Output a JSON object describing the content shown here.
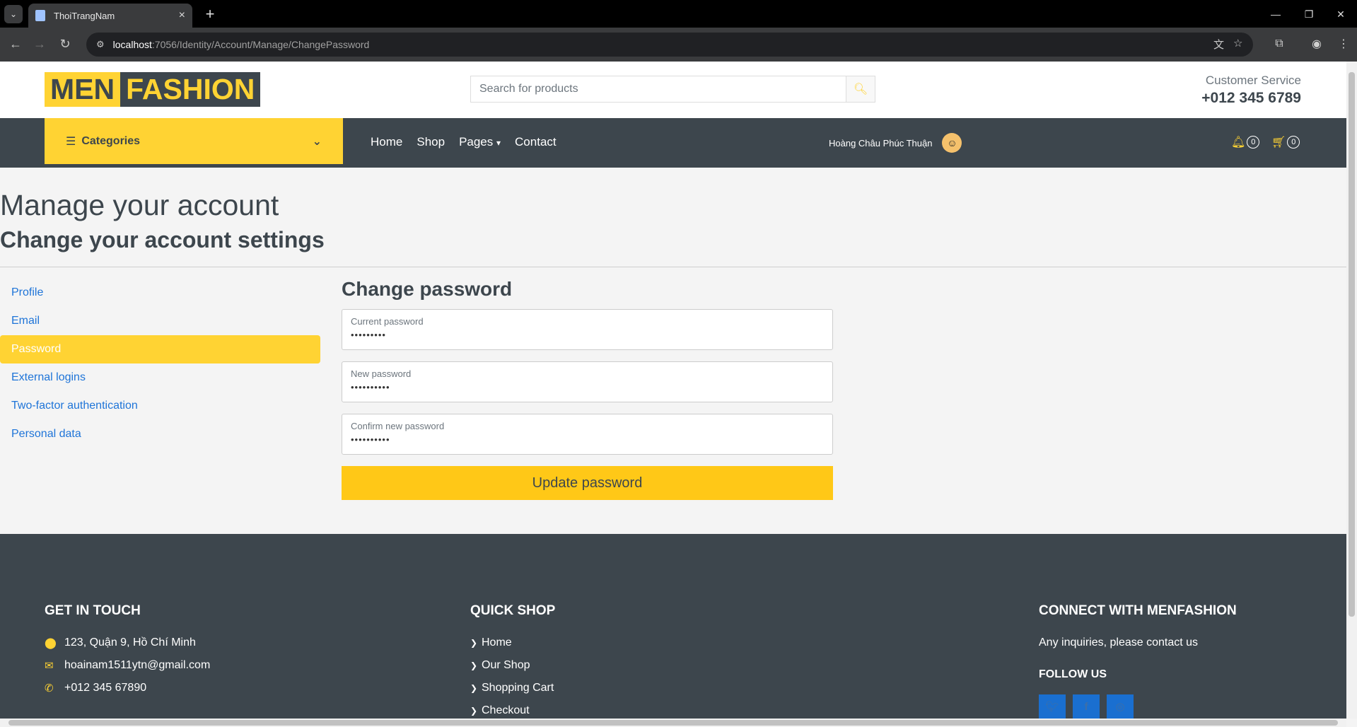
{
  "browser": {
    "tab_title": "ThoiTrangNam",
    "url_host": "localhost",
    "url_path": ":7056/Identity/Account/Manage/ChangePassword"
  },
  "header": {
    "logo_part1": "MEN",
    "logo_part2": "FASHION",
    "search_placeholder": "Search for products",
    "customer_service_label": "Customer Service",
    "customer_service_phone": "+012 345 6789"
  },
  "navbar": {
    "categories_label": "Categories",
    "links": [
      "Home",
      "Shop",
      "Pages",
      "Contact"
    ],
    "user_name": "Hoàng Châu Phúc Thuận",
    "notification_count": "0",
    "cart_count": "0"
  },
  "page": {
    "title": "Manage your account",
    "subtitle": "Change your account settings"
  },
  "sidebar": {
    "items": [
      "Profile",
      "Email",
      "Password",
      "External logins",
      "Two-factor authentication",
      "Personal data"
    ],
    "active": "Password"
  },
  "form": {
    "title": "Change password",
    "fields": [
      {
        "label": "Current password",
        "value": "•••••••••"
      },
      {
        "label": "New password",
        "value": "••••••••••"
      },
      {
        "label": "Confirm new password",
        "value": "••••••••••"
      }
    ],
    "submit_label": "Update password"
  },
  "footer": {
    "get_in_touch": {
      "title": "GET IN TOUCH",
      "address": "123, Quận 9, Hồ Chí Minh",
      "email": "hoainam1511ytn@gmail.com",
      "phone": "+012 345 67890"
    },
    "quick_shop": {
      "title": "QUICK SHOP",
      "links": [
        "Home",
        "Our Shop",
        "Shopping Cart",
        "Checkout"
      ]
    },
    "connect": {
      "title": "CONNECT WITH MENFASHION",
      "text": "Any inquiries, please contact us",
      "follow_title": "FOLLOW US"
    }
  },
  "colors": {
    "accent": "#ffd333",
    "dark": "#3d464d",
    "link": "#1e74d8"
  },
  "icons": [
    "search-icon",
    "bars-icon",
    "chevron-down-icon",
    "bell-icon",
    "cart-icon",
    "map-marker-icon",
    "envelope-icon",
    "phone-icon",
    "chevron-right-icon",
    "twitter-icon",
    "facebook-icon",
    "instagram-icon"
  ]
}
